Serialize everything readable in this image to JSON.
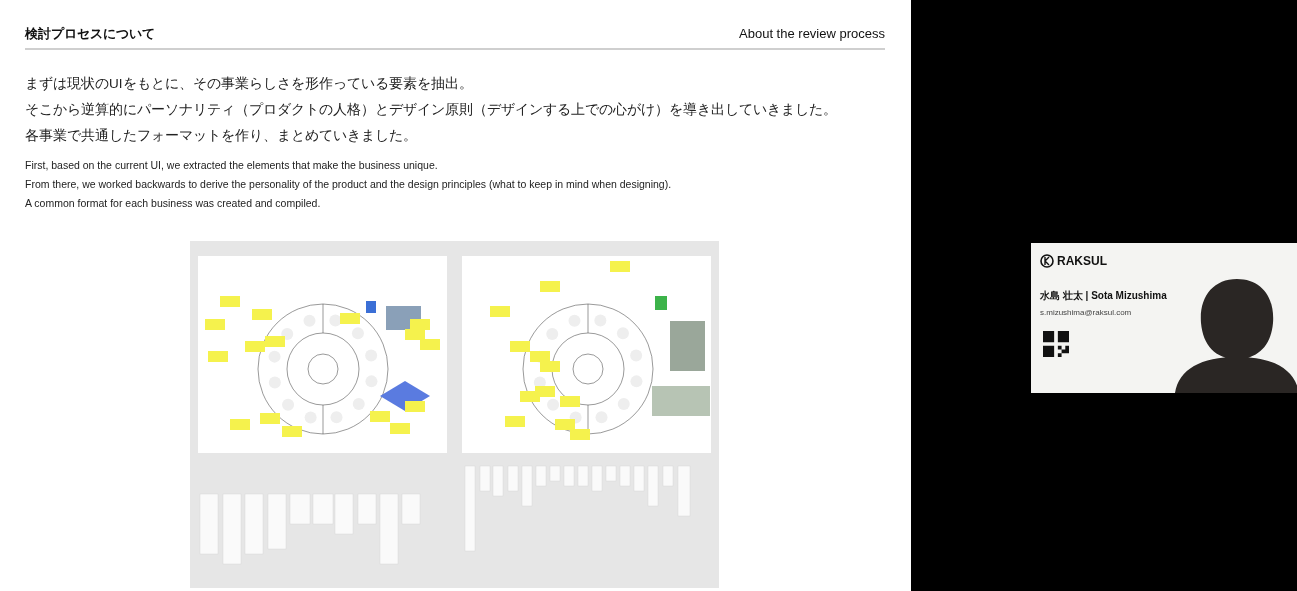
{
  "slide": {
    "title": "検討プロセスについて",
    "title_en": "About the review process",
    "body_ja": [
      "まずは現状のUIをもとに、その事業らしさを形作っている要素を抽出。",
      "そこから逆算的にパーソナリティ（プロダクトの人格）とデザイン原則（デザインする上での心がけ）を導き出していきました。",
      "各事業で共通したフォーマットを作り、まとめていきました。"
    ],
    "body_en": [
      "First, based on the current UI, we extracted the elements that make the business unique.",
      "From there, we worked backwards to derive the personality of the product and the design principles (what to keep in mind when designing).",
      "A common format for each business was created and compiled."
    ]
  },
  "speaker_card": {
    "brand": "RAKSUL",
    "name": "水島 壮太 | Sota Mizushima",
    "email": "s.mizushima@raksul.com"
  }
}
